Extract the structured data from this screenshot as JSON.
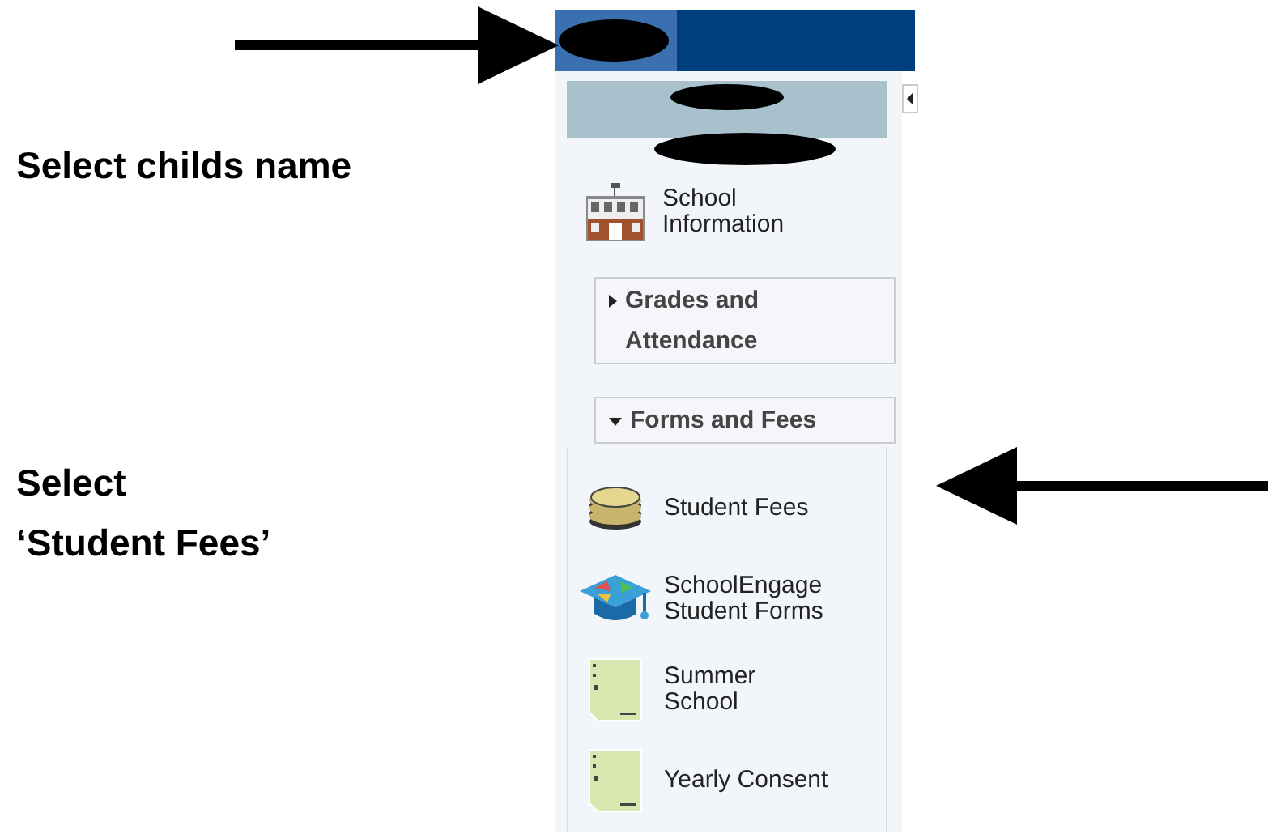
{
  "instructions": [
    {
      "lines": [
        "Select childs name"
      ]
    },
    {
      "lines": [
        "Select",
        "‘Student Fees’"
      ]
    }
  ],
  "menu": [
    {
      "kind": "link",
      "lines": [
        "School",
        "Information"
      ]
    },
    {
      "kind": "section",
      "label": "Grades and Attendance",
      "expanded": false
    },
    {
      "kind": "section",
      "label": "Forms and Fees",
      "expanded": true,
      "children": [
        {
          "lines": [
            "Student Fees"
          ]
        },
        {
          "lines": [
            "SchoolEngage",
            "Student Forms"
          ]
        },
        {
          "lines": [
            "Summer",
            "School"
          ]
        },
        {
          "lines": [
            "Yearly Consent"
          ]
        }
      ]
    }
  ]
}
